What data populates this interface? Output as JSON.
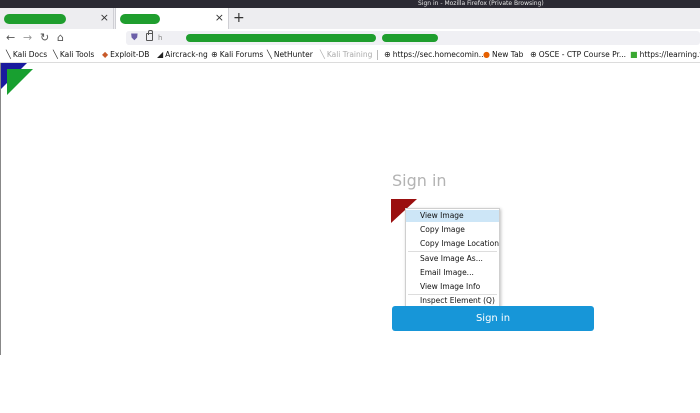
{
  "window": {
    "title": "Sign in - Mozilla Firefox (Private Browsing)"
  },
  "tabs": [
    {
      "label": "",
      "close": "×"
    },
    {
      "label": "",
      "close": "×"
    }
  ],
  "newtab_glyph": "+",
  "nav": {
    "back": "←",
    "forward": "→",
    "reload": "↻",
    "home": "⌂"
  },
  "urlbar": {
    "visible_text": "h"
  },
  "bookmarks": [
    {
      "label": "Kali Docs",
      "icon": "dragon-icon"
    },
    {
      "label": "Kali Tools",
      "icon": "dragon-icon"
    },
    {
      "label": "Exploit-DB",
      "icon": "exploitdb-icon"
    },
    {
      "label": "Aircrack-ng",
      "icon": "aircrack-icon"
    },
    {
      "label": "Kali Forums",
      "icon": "globe-icon"
    },
    {
      "label": "NetHunter",
      "icon": "dragon-icon"
    },
    {
      "label": "Kali Training",
      "icon": "dragon-icon"
    },
    {
      "label": "https://sec.homecomin...",
      "icon": "globe-icon"
    },
    {
      "label": "New Tab",
      "icon": "firefox-icon"
    },
    {
      "label": "OSCE - CTP Course Pr...",
      "icon": "globe-icon"
    },
    {
      "label": "https://learning.f",
      "icon": "green-leaf-icon"
    }
  ],
  "page": {
    "heading": "Sign in",
    "button": "Sign in"
  },
  "context_menu": [
    {
      "label": "View Image",
      "highlighted": true
    },
    {
      "label": "Copy Image"
    },
    {
      "label": "Copy Image Location"
    },
    {
      "label": "Save Image As..."
    },
    {
      "label": "Email Image..."
    },
    {
      "label": "View Image Info"
    },
    {
      "label": "Inspect Element (Q)"
    }
  ],
  "colors": {
    "button": "#1796d8",
    "highlight": "#cde6f7",
    "redaction": "#1f9e2e",
    "titlebar": "#2b2a33"
  }
}
